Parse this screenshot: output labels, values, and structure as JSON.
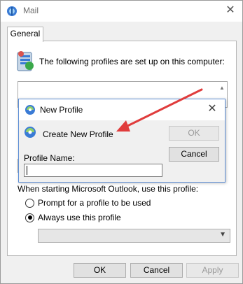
{
  "window": {
    "title": "Mail",
    "close_glyph": "✕",
    "icon": "mail-settings-icon"
  },
  "tab": {
    "label": "General"
  },
  "profiles": {
    "description": "The following profiles are set up on this computer:",
    "icon": "profiles-icon",
    "list_items": []
  },
  "startup": {
    "label": "When starting Microsoft Outlook, use this profile:",
    "options": [
      {
        "label": "Prompt for a profile to be used",
        "checked": false
      },
      {
        "label": "Always use this profile",
        "checked": true
      }
    ],
    "selected_profile": ""
  },
  "footer": {
    "ok_label": "OK",
    "cancel_label": "Cancel",
    "apply_label": "Apply"
  },
  "dialog": {
    "title": "New Profile",
    "subtitle": "Create New Profile",
    "ok_label": "OK",
    "cancel_label": "Cancel",
    "field_label": "Profile Name:",
    "field_value": "",
    "close_glyph": "✕"
  },
  "colors": {
    "annotation_arrow": "#e03c3c",
    "focus_border": "#0078d7"
  }
}
